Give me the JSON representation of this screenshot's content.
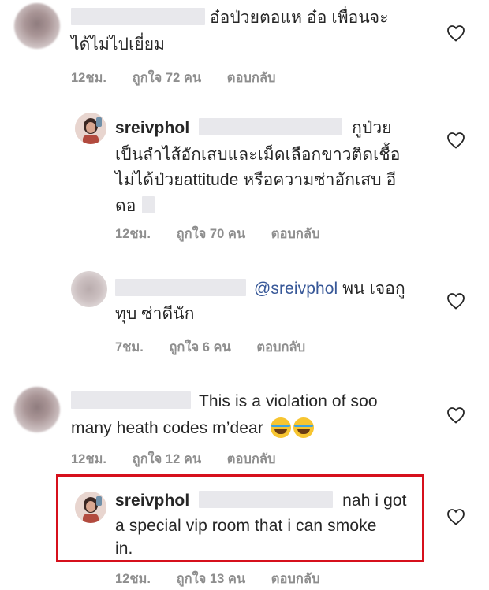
{
  "comments": [
    {
      "text": "อ๋อป่วยตอแห   อ๋อ เพื่อนจะ",
      "text2": "ได้ไม่ไปเยี่ยม",
      "time": "12ชม.",
      "likes": "ถูกใจ 72 คน",
      "reply": "ตอบกลับ"
    },
    {
      "username": "sreivphol",
      "text": "กูป่วย",
      "text2": "เป็นลำไส้อักเสบและเม็ดเลือกขาวติดเชื้อ",
      "text3": "ไม่ได้ป่วยattitude หรือความซ่าอักเสบ อี",
      "text4": "ดอ",
      "time": "12ชม.",
      "likes": "ถูกใจ 70 คน",
      "reply": "ตอบกลับ"
    },
    {
      "mention": "@sreivphol",
      "text": "พน เจอกู",
      "text2": "ทุบ ซ่าดีนัก",
      "time": "7ชม.",
      "likes": "ถูกใจ 6 คน",
      "reply": "ตอบกลับ"
    },
    {
      "text": "This is a violation of soo",
      "text2": "many heath codes m’dear",
      "time": "12ชม.",
      "likes": "ถูกใจ 12 คน",
      "reply": "ตอบกลับ"
    },
    {
      "username": "sreivphol",
      "text": "nah i got",
      "text2": "a special  vip room that i can smoke",
      "text3": "in.",
      "time": "12ชม.",
      "likes": "ถูกใจ 13 คน",
      "reply": "ตอบกลับ"
    }
  ],
  "colors": {
    "highlight": "#d6101c",
    "meta": "#8e8e8e",
    "mention": "#385898"
  }
}
